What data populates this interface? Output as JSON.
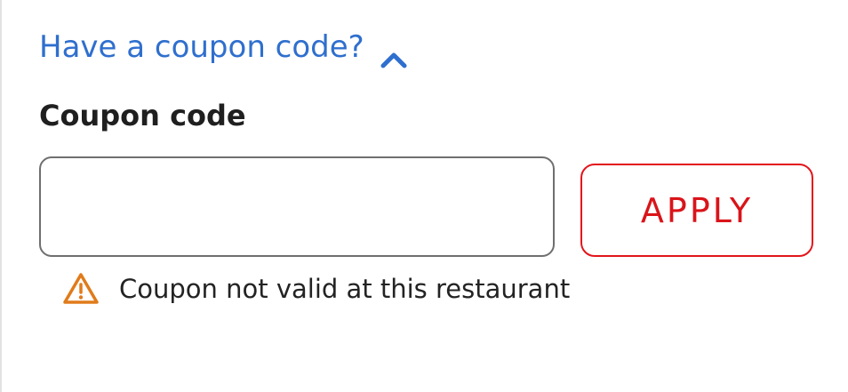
{
  "coupon_section": {
    "toggle_label": "Have a coupon code?",
    "toggle_icon": "chevron-up-icon",
    "field_label": "Coupon code",
    "input_value": "",
    "input_placeholder": "",
    "apply_label": "APPLY",
    "error_icon": "warning-icon",
    "error_message": "Coupon not valid at this restaurant"
  },
  "colors": {
    "link": "#2f6fce",
    "accent": "#e3151b",
    "warning": "#e07b1a",
    "text": "#1f1f1f",
    "input_border": "#6f6f6f"
  }
}
